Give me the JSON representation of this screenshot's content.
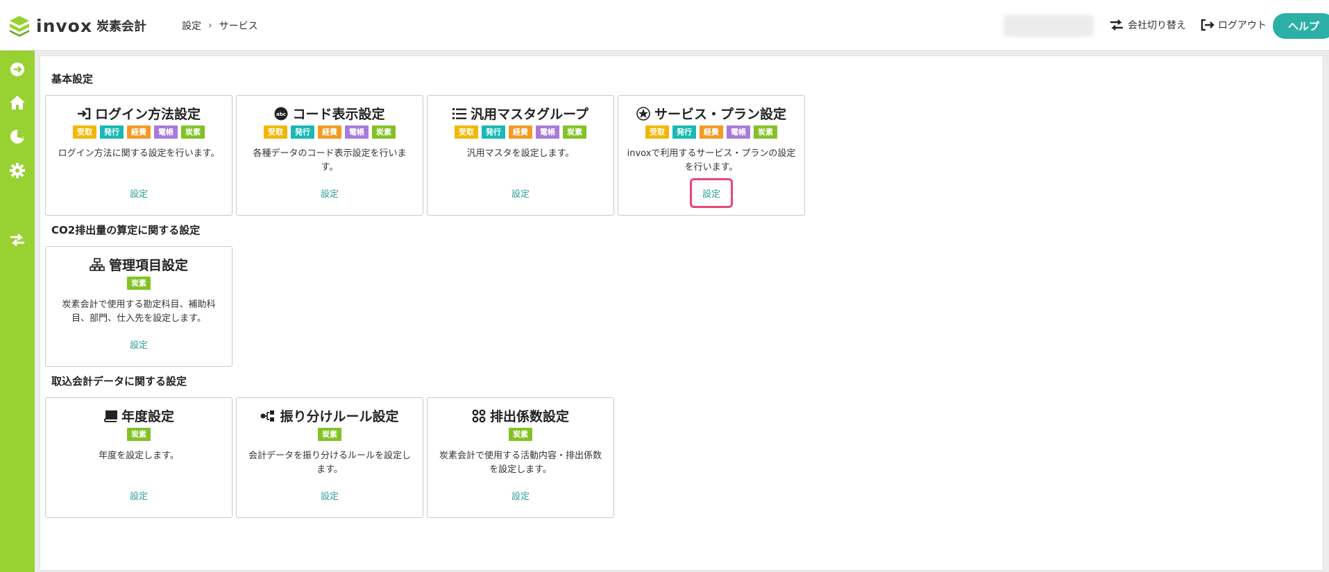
{
  "header": {
    "logo_text": "invox",
    "logo_sub": "炭素会計",
    "breadcrumb": [
      "設定",
      "サービス"
    ],
    "switch_company": "会社切り替え",
    "logout": "ログアウト",
    "help": "ヘルプ"
  },
  "colors": {
    "brand_green": "#98d132",
    "accent_teal": "#2cb0a6",
    "highlight": "#e8437a"
  },
  "sections": [
    {
      "title": "基本設定",
      "cards": [
        {
          "title": "ログイン方法設定",
          "icon": "login-icon",
          "tags": [
            "受取",
            "発行",
            "経費",
            "電帳",
            "炭素"
          ],
          "desc": "ログイン方法に関する設定を行います。",
          "link": "設定"
        },
        {
          "title": "コード表示設定",
          "icon": "abc-icon",
          "tags": [
            "受取",
            "発行",
            "経費",
            "電帳",
            "炭素"
          ],
          "desc": "各種データのコード表示設定を行います。",
          "link": "設定"
        },
        {
          "title": "汎用マスタグループ",
          "icon": "list-icon",
          "tags": [
            "受取",
            "発行",
            "経費",
            "電帳",
            "炭素"
          ],
          "desc": "汎用マスタを設定します。",
          "link": "設定"
        },
        {
          "title": "サービス・プラン設定",
          "icon": "star-badge-icon",
          "tags": [
            "受取",
            "発行",
            "経費",
            "電帳",
            "炭素"
          ],
          "desc": "invoxで利用するサービス・プランの設定を行います。",
          "link": "設定"
        }
      ]
    },
    {
      "title": "CO2排出量の算定に関する設定",
      "cards": [
        {
          "title": "管理項目設定",
          "icon": "hierarchy-icon",
          "tags": [
            "炭素"
          ],
          "desc": "炭素会計で使用する勘定科目、補助科目、部門、仕入先を設定します。",
          "link": "設定"
        }
      ]
    },
    {
      "title": "取込会計データに関する設定",
      "cards": [
        {
          "title": "年度設定",
          "icon": "book-icon",
          "tags": [
            "炭素"
          ],
          "desc": "年度を設定します。",
          "link": "設定"
        },
        {
          "title": "振り分けルール設定",
          "icon": "split-icon",
          "tags": [
            "炭素"
          ],
          "desc": "会計データを振り分けるルールを設定します。",
          "link": "設定"
        },
        {
          "title": "排出係数設定",
          "icon": "dots-grid-icon",
          "tags": [
            "炭素"
          ],
          "desc": "炭素会計で使用する活動内容・排出係数を設定します。",
          "link": "設定"
        }
      ]
    }
  ]
}
